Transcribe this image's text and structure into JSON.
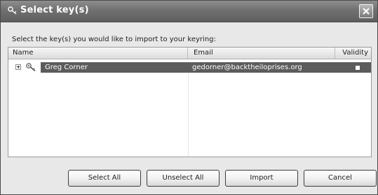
{
  "window": {
    "title": "Select key(s)"
  },
  "instruction": "Select the key(s) you would like to import to your keyring:",
  "list": {
    "columns": {
      "name": "Name",
      "email": "Email",
      "validity": "Validity"
    },
    "rows": [
      {
        "name": "Greg Corner",
        "email": "gedorner@backtheiloprises.org",
        "validity_icon": "square-icon",
        "selected": true
      }
    ]
  },
  "buttons": {
    "select_all": "Select All",
    "unselect_all": "Unselect All",
    "import": "Import",
    "cancel": "Cancel"
  },
  "colors": {
    "titlebar": "#707070",
    "selection": "#5c5c5c",
    "dialog_background": "#e8e8e8"
  }
}
